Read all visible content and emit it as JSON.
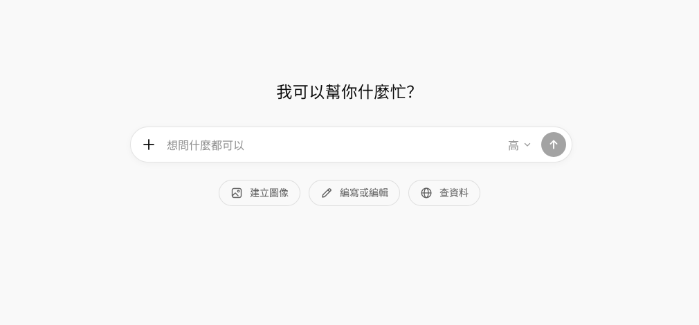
{
  "main": {
    "headline": "我可以幫你什麼忙？"
  },
  "composer": {
    "add_icon": "plus-icon",
    "placeholder": "想問什麼都可以",
    "model_label": "高",
    "model_icon": "chevron-down-icon",
    "send_icon": "arrow-up-icon",
    "send_color": "#a3a3a3"
  },
  "suggestions": [
    {
      "label": "建立圖像",
      "icon": "image-icon"
    },
    {
      "label": "編寫或編輯",
      "icon": "pencil-icon"
    },
    {
      "label": "查資料",
      "icon": "globe-icon"
    }
  ]
}
